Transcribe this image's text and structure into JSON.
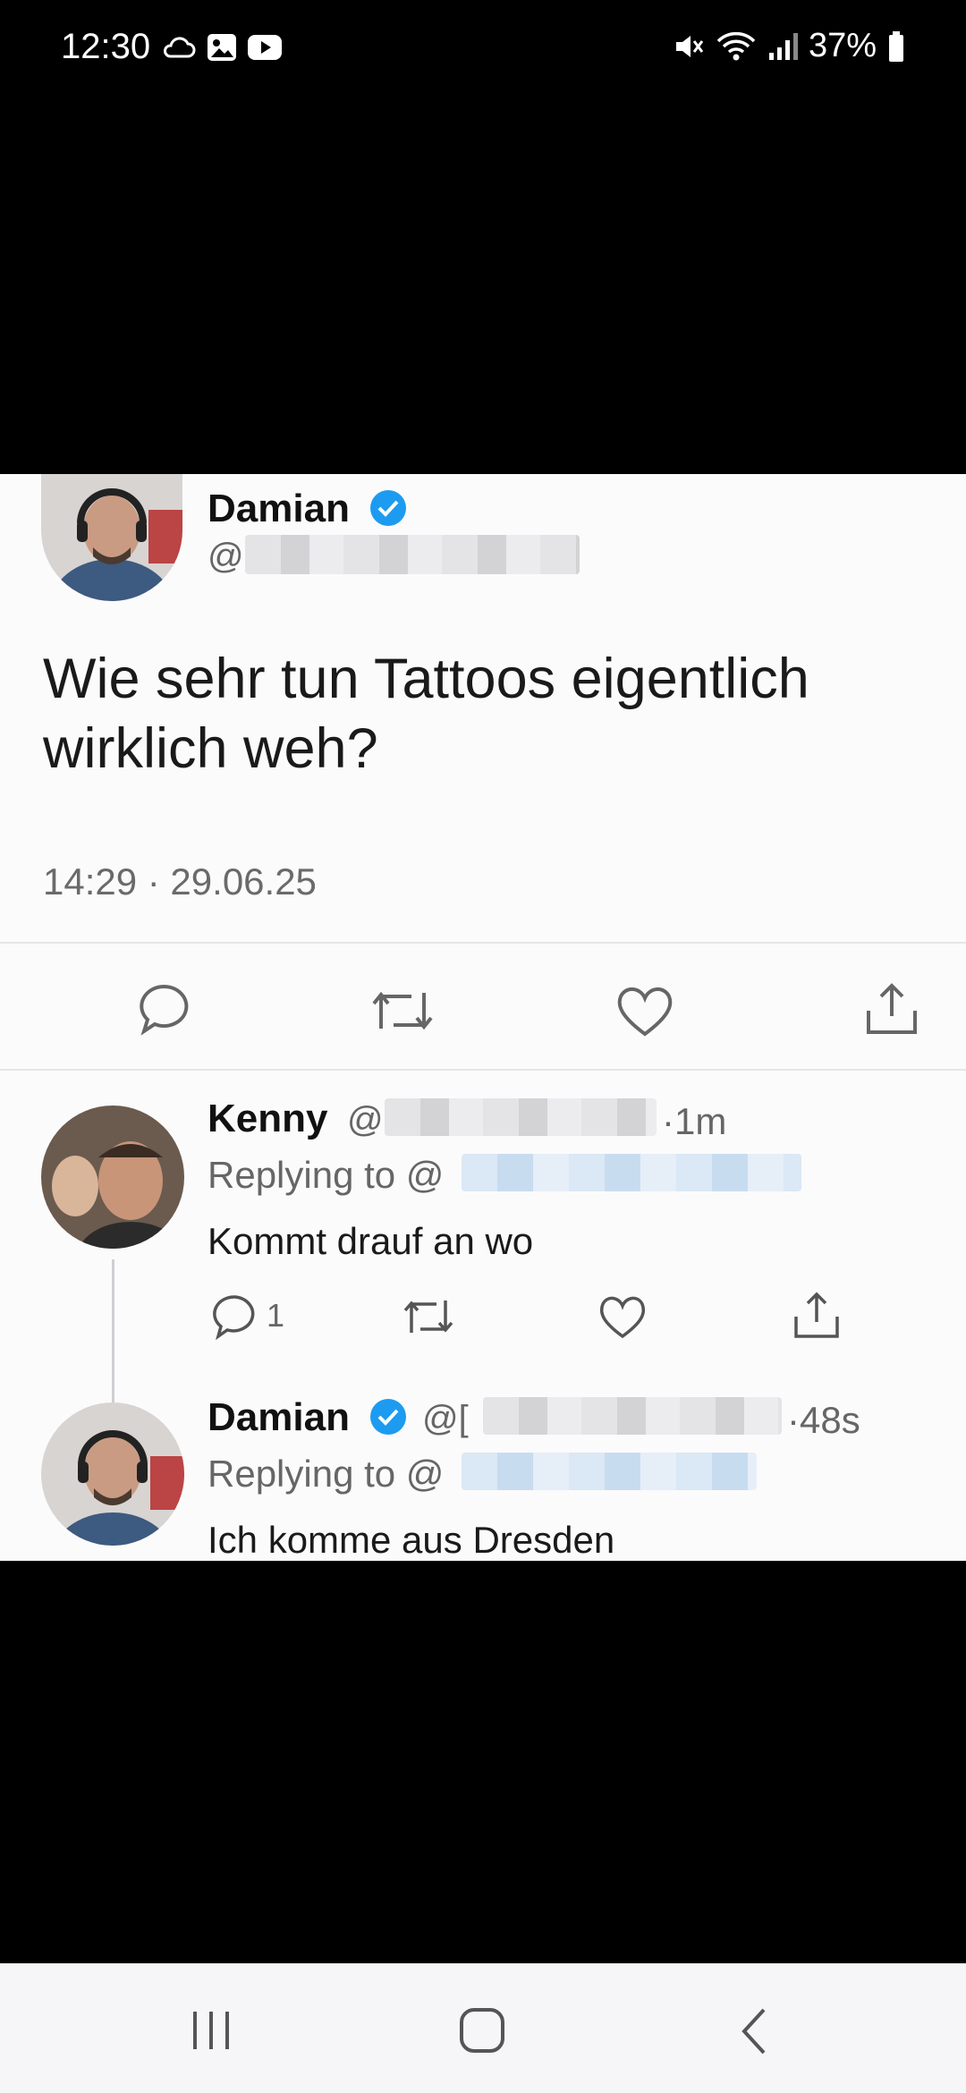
{
  "status_bar": {
    "time": "12:30",
    "battery": "37%"
  },
  "main_tweet": {
    "author": "Damian",
    "handle_prefix": "@",
    "text_line1": "Wie sehr tun Tattoos eigentlich",
    "text_line2": "wirklich weh?",
    "timestamp": "14:29 · 29.06.25"
  },
  "reply1": {
    "author": "Kenny",
    "handle_prefix": "@",
    "age": "·1m",
    "replying_to": "Replying to @",
    "text": "Kommt drauf an wo",
    "reply_count": "1"
  },
  "reply2": {
    "author": "Damian",
    "handle_prefix": "@[",
    "age": "·48s",
    "replying_to": "Replying to @",
    "text": "Ich komme aus Dresden"
  },
  "colors": {
    "verified": "#1d9bf0",
    "icon_gray": "#666666"
  }
}
